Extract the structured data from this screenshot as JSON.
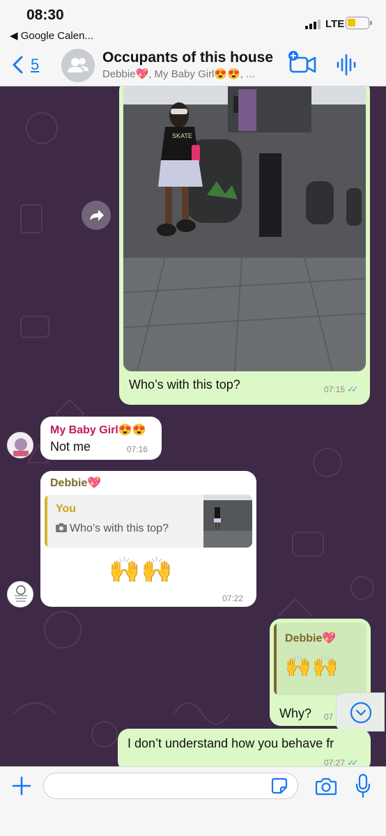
{
  "status_bar": {
    "time": "08:30",
    "back_app": "◀ Google Calen...",
    "network": "LTE",
    "battery_color": "#f2c200"
  },
  "header": {
    "unread_count": "5",
    "title": "Occupants of this house",
    "subtitle": "Debbie💖, My Baby Girl😍😍, ...",
    "accent": "#1877f2"
  },
  "messages": [
    {
      "id": "photo",
      "direction": "outgoing",
      "type": "image",
      "caption": "Who’s with this top?",
      "time": "07:15",
      "status": "read",
      "shirt_text": "SKATE"
    },
    {
      "id": "my-baby-girl",
      "direction": "incoming",
      "sender": "My Baby Girl😍😍",
      "sender_color": "#c2185b",
      "text": "Not me",
      "time": "07:16"
    },
    {
      "id": "debbie-reply",
      "direction": "incoming",
      "sender": "Debbie💖",
      "sender_color": "#7a6a2a",
      "quote_name": "You",
      "quote_text": "Who’s with this top?",
      "emojis": "🙌🙌",
      "time": "07:22"
    },
    {
      "id": "why",
      "direction": "outgoing",
      "quote_name": "Debbie💖",
      "quote_emojis": "🙌🙌",
      "text": "Why?",
      "time": "07"
    },
    {
      "id": "behave",
      "direction": "outgoing",
      "text": "I don’t understand how you behave fr",
      "time": "07:27",
      "status": "read"
    }
  ],
  "composer": {
    "placeholder": ""
  }
}
